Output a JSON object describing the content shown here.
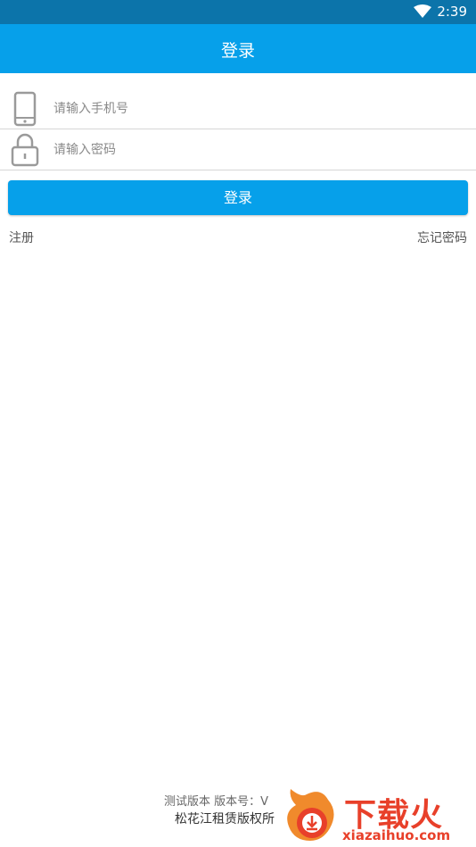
{
  "status_bar": {
    "time": "2:39",
    "icons": [
      "wifi-icon"
    ]
  },
  "app_bar": {
    "title": "登录"
  },
  "form": {
    "phone": {
      "placeholder": "请输入手机号",
      "value": "",
      "icon": "phone-icon"
    },
    "password": {
      "placeholder": "请输入密码",
      "value": "",
      "icon": "lock-icon"
    },
    "login_button": "登录"
  },
  "links": {
    "register": "注册",
    "forgot_password": "忘记密码"
  },
  "footer": {
    "version_line": "测试版本  版本号：V",
    "copyright_line": "松花江租赁版权所"
  },
  "watermark": {
    "text": "下载火",
    "url": "xiazaihuo.com"
  },
  "colors": {
    "accent": "#06a0ea",
    "status_bar": "#0c74aa",
    "watermark": "#e8402a"
  }
}
